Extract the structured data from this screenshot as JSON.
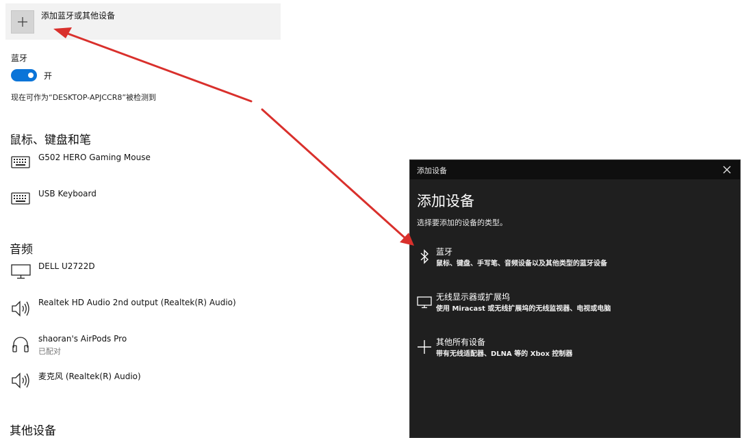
{
  "settings": {
    "add_device_label": "添加蓝牙或其他设备",
    "bluetooth_label": "蓝牙",
    "bluetooth_state": "开",
    "discoverable_text": "现在可作为“DESKTOP-APJCCR8”被检测到",
    "sections": {
      "mouse_keyboard_pen": "鼠标、键盘和笔",
      "audio": "音频",
      "other_devices": "其他设备"
    },
    "devices": {
      "mouse": "G502 HERO Gaming Mouse",
      "keyboard": "USB Keyboard",
      "monitor": "DELL U2722D",
      "realtek_output": "Realtek HD Audio 2nd output (Realtek(R) Audio)",
      "airpods": "shaoran's AirPods Pro",
      "airpods_status": "已配对",
      "microphone": "麦克风 (Realtek(R) Audio)"
    }
  },
  "dialog": {
    "window_title": "添加设备",
    "heading": "添加设备",
    "subtitle": "选择要添加的设备的类型。",
    "options": [
      {
        "title": "蓝牙",
        "desc": "鼠标、键盘、手写笔、音频设备以及其他类型的蓝牙设备",
        "icon": "bluetooth-icon"
      },
      {
        "title": "无线显示器或扩展坞",
        "desc": "使用 Miracast 或无线扩展坞的无线监视器、电视或电脑",
        "icon": "monitor-icon"
      },
      {
        "title": "其他所有设备",
        "desc": "带有无线适配器、DLNA 等的 Xbox 控制器",
        "icon": "plus-icon"
      }
    ]
  },
  "colors": {
    "accent": "#0a74d8",
    "arrow": "#d9302c",
    "dialog_bg": "#1f1f1f"
  }
}
